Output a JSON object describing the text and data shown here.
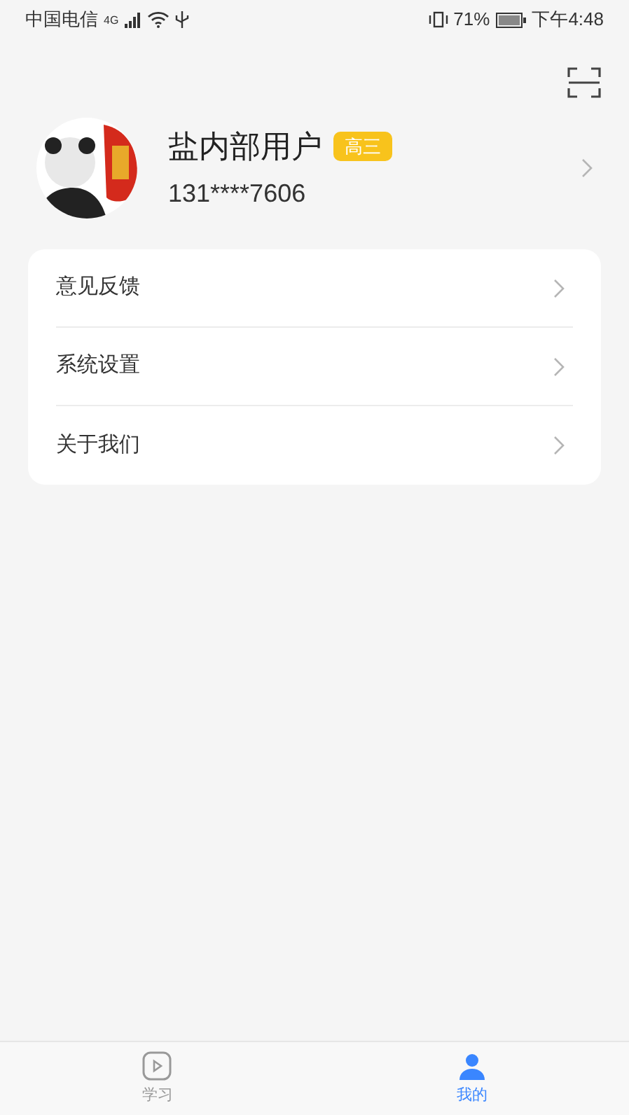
{
  "status_bar": {
    "carrier": "中国电信",
    "signal_label": "4G",
    "battery": "71%",
    "time": "下午4:48"
  },
  "profile": {
    "name": "盐内部用户",
    "grade": "高三",
    "phone": "131****7606"
  },
  "menu": [
    {
      "label": "意见反馈"
    },
    {
      "label": "系统设置"
    },
    {
      "label": "关于我们"
    }
  ],
  "tabs": [
    {
      "label": "学习",
      "kind": "play",
      "selected": false
    },
    {
      "label": "我的",
      "kind": "person",
      "selected": true
    }
  ]
}
